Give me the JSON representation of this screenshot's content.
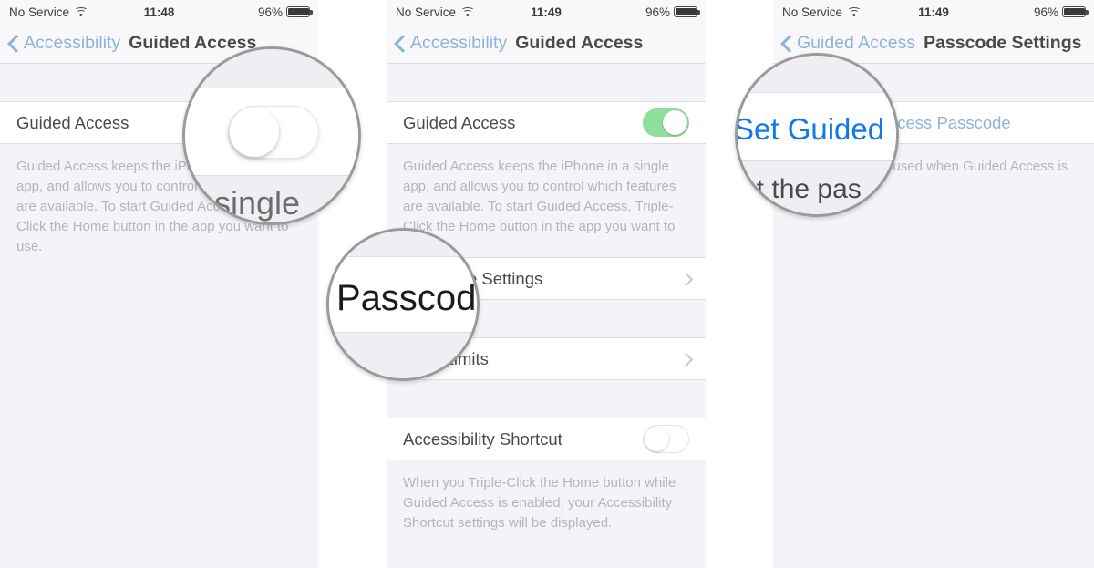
{
  "panels": [
    {
      "status": {
        "carrier": "No Service",
        "wifi_icon": "wifi-icon",
        "time": "11:48",
        "battery_percent": "96%",
        "battery_icon": "battery-icon"
      },
      "nav": {
        "back_icon": "back-chevron-icon",
        "back_label": "Accessibility",
        "title": "Guided Access"
      },
      "rows": [
        {
          "label": "Guided Access",
          "control": "toggle",
          "state": "off"
        }
      ],
      "footnote": "Guided Access keeps the iPhone in a single app, and allows you to control which features are available. To start Guided Access, Triple-Click the Home button in the app you want to use."
    },
    {
      "status": {
        "carrier": "No Service",
        "wifi_icon": "wifi-icon",
        "time": "11:49",
        "battery_percent": "96%",
        "battery_icon": "battery-icon"
      },
      "nav": {
        "back_icon": "back-chevron-icon",
        "back_label": "Accessibility",
        "title": "Guided Access"
      },
      "rows": [
        {
          "label": "Guided Access",
          "control": "toggle",
          "state": "on"
        },
        {
          "label": "Passcode Settings",
          "control": "chevron"
        },
        {
          "label": "Time Limits",
          "control": "chevron"
        },
        {
          "label": "Accessibility Shortcut",
          "control": "toggle",
          "state": "off"
        }
      ],
      "footnote": "Guided Access keeps the iPhone in a single app, and allows you to control which features are available. To start Guided Access, Triple-Click the Home button in the app you want to",
      "footnote2": "When you Triple-Click the Home button while Guided Access is enabled, your Accessibility Shortcut settings will be displayed."
    },
    {
      "status": {
        "carrier": "No Service",
        "wifi_icon": "wifi-icon",
        "time": "11:49",
        "battery_percent": "96%",
        "battery_icon": "battery-icon"
      },
      "nav": {
        "back_icon": "back-chevron-icon",
        "back_label": "Guided Access",
        "title": "Passcode Settings"
      },
      "rows": [
        {
          "label": "Set Guided Access Passcode",
          "control": "link"
        }
      ],
      "footnote": "The passcode is used when Guided Access is enabled.",
      "footnote2": "Set the passcode"
    }
  ],
  "magnifiers": [
    {
      "name": "guided-access-toggle",
      "word": "single"
    },
    {
      "name": "passcode-settings-row",
      "word": "Passcode"
    },
    {
      "name": "set-guided-access-passcode-link",
      "word": "Set Guided",
      "word2": "et the pas"
    }
  ],
  "colors": {
    "accent_blue": "#8cb4dd",
    "link_blue": "#1277e8",
    "toggle_green": "#8ede9c",
    "background_gray": "#f4f4f8",
    "text_dark": "#4a4a4a",
    "text_muted": "#b4b4bb"
  }
}
